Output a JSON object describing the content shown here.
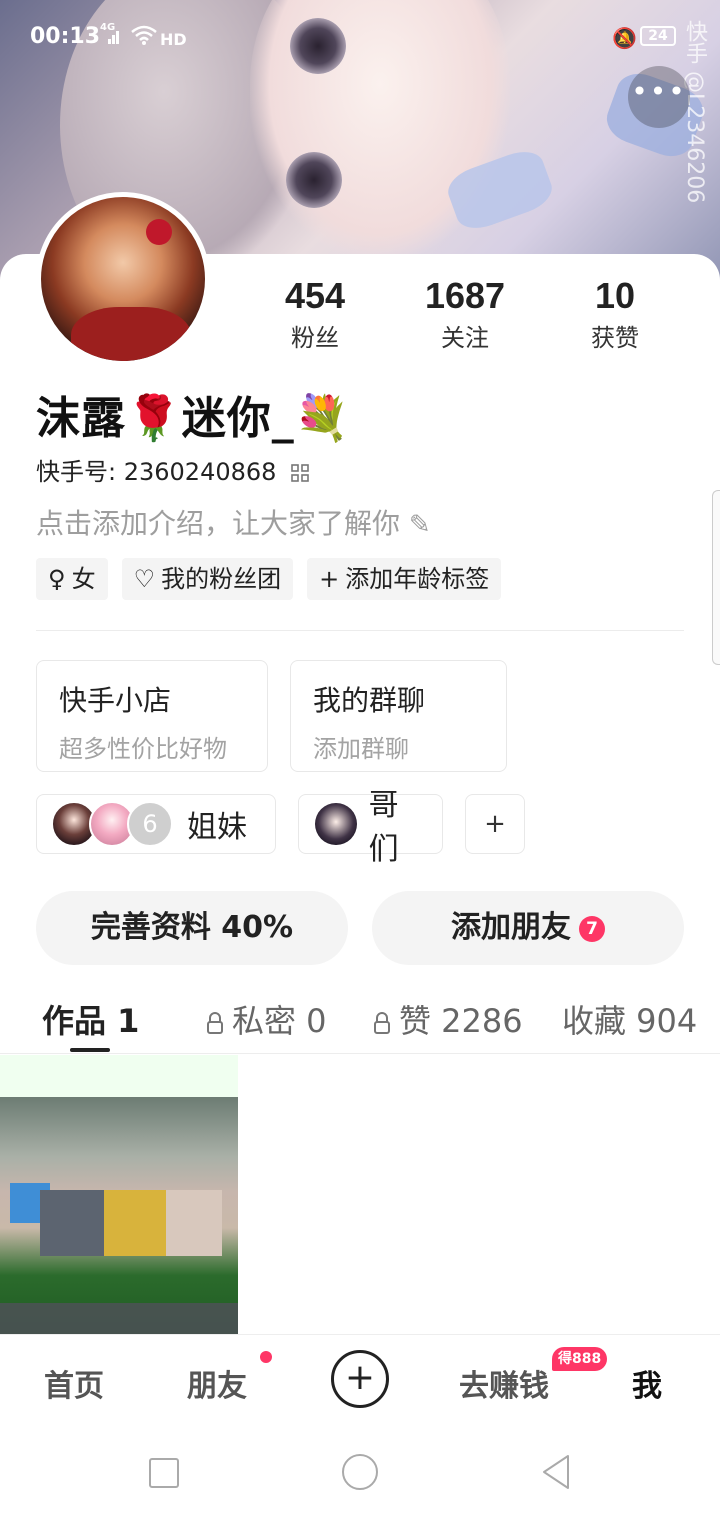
{
  "status_bar": {
    "time": "00:13",
    "network": "4G",
    "wifi_label": "HD",
    "battery": "24"
  },
  "header": {
    "watermark": "快手 @L2346206",
    "more_label": "•••"
  },
  "profile": {
    "stats": [
      {
        "value": "454",
        "label": "粉丝"
      },
      {
        "value": "1687",
        "label": "关注"
      },
      {
        "value": "10",
        "label": "获赞"
      }
    ],
    "name_part1": "沫露",
    "name_rose": "🌹",
    "name_part2": "迷你_",
    "name_bouquet": "💐",
    "kuaishou_id_label": "快手号: ",
    "kuaishou_id": "2360240868",
    "intro_placeholder": "点击添加介绍，让大家了解你",
    "intro_edit": "✎",
    "tags": [
      {
        "icon": "♀",
        "label": "女"
      },
      {
        "icon": "♡",
        "label": "我的粉丝团"
      },
      {
        "icon": "+",
        "label": "添加年龄标签"
      }
    ]
  },
  "features": [
    {
      "title": "快手小店",
      "subtitle": "超多性价比好物"
    },
    {
      "title": "我的群聊",
      "subtitle": "添加群聊"
    }
  ],
  "groups": [
    {
      "label": "姐妹",
      "count": "6"
    },
    {
      "label": "哥们"
    }
  ],
  "add_group": "+",
  "actions": {
    "complete_profile": "完善资料 40%",
    "add_friends": "添加朋友",
    "add_friends_badge": "7"
  },
  "tabs": [
    {
      "label": "作品 1",
      "locked": false,
      "active": true
    },
    {
      "label": "私密 0",
      "locked": true
    },
    {
      "label": "赞 2286",
      "locked": true
    },
    {
      "label": "收藏 904",
      "locked": false
    }
  ],
  "bottom_tabs": [
    {
      "label": "首页"
    },
    {
      "label": "朋友"
    },
    {
      "label": "+"
    },
    {
      "label": "去赚钱",
      "badge": "得888"
    },
    {
      "label": "我",
      "active": true
    }
  ]
}
